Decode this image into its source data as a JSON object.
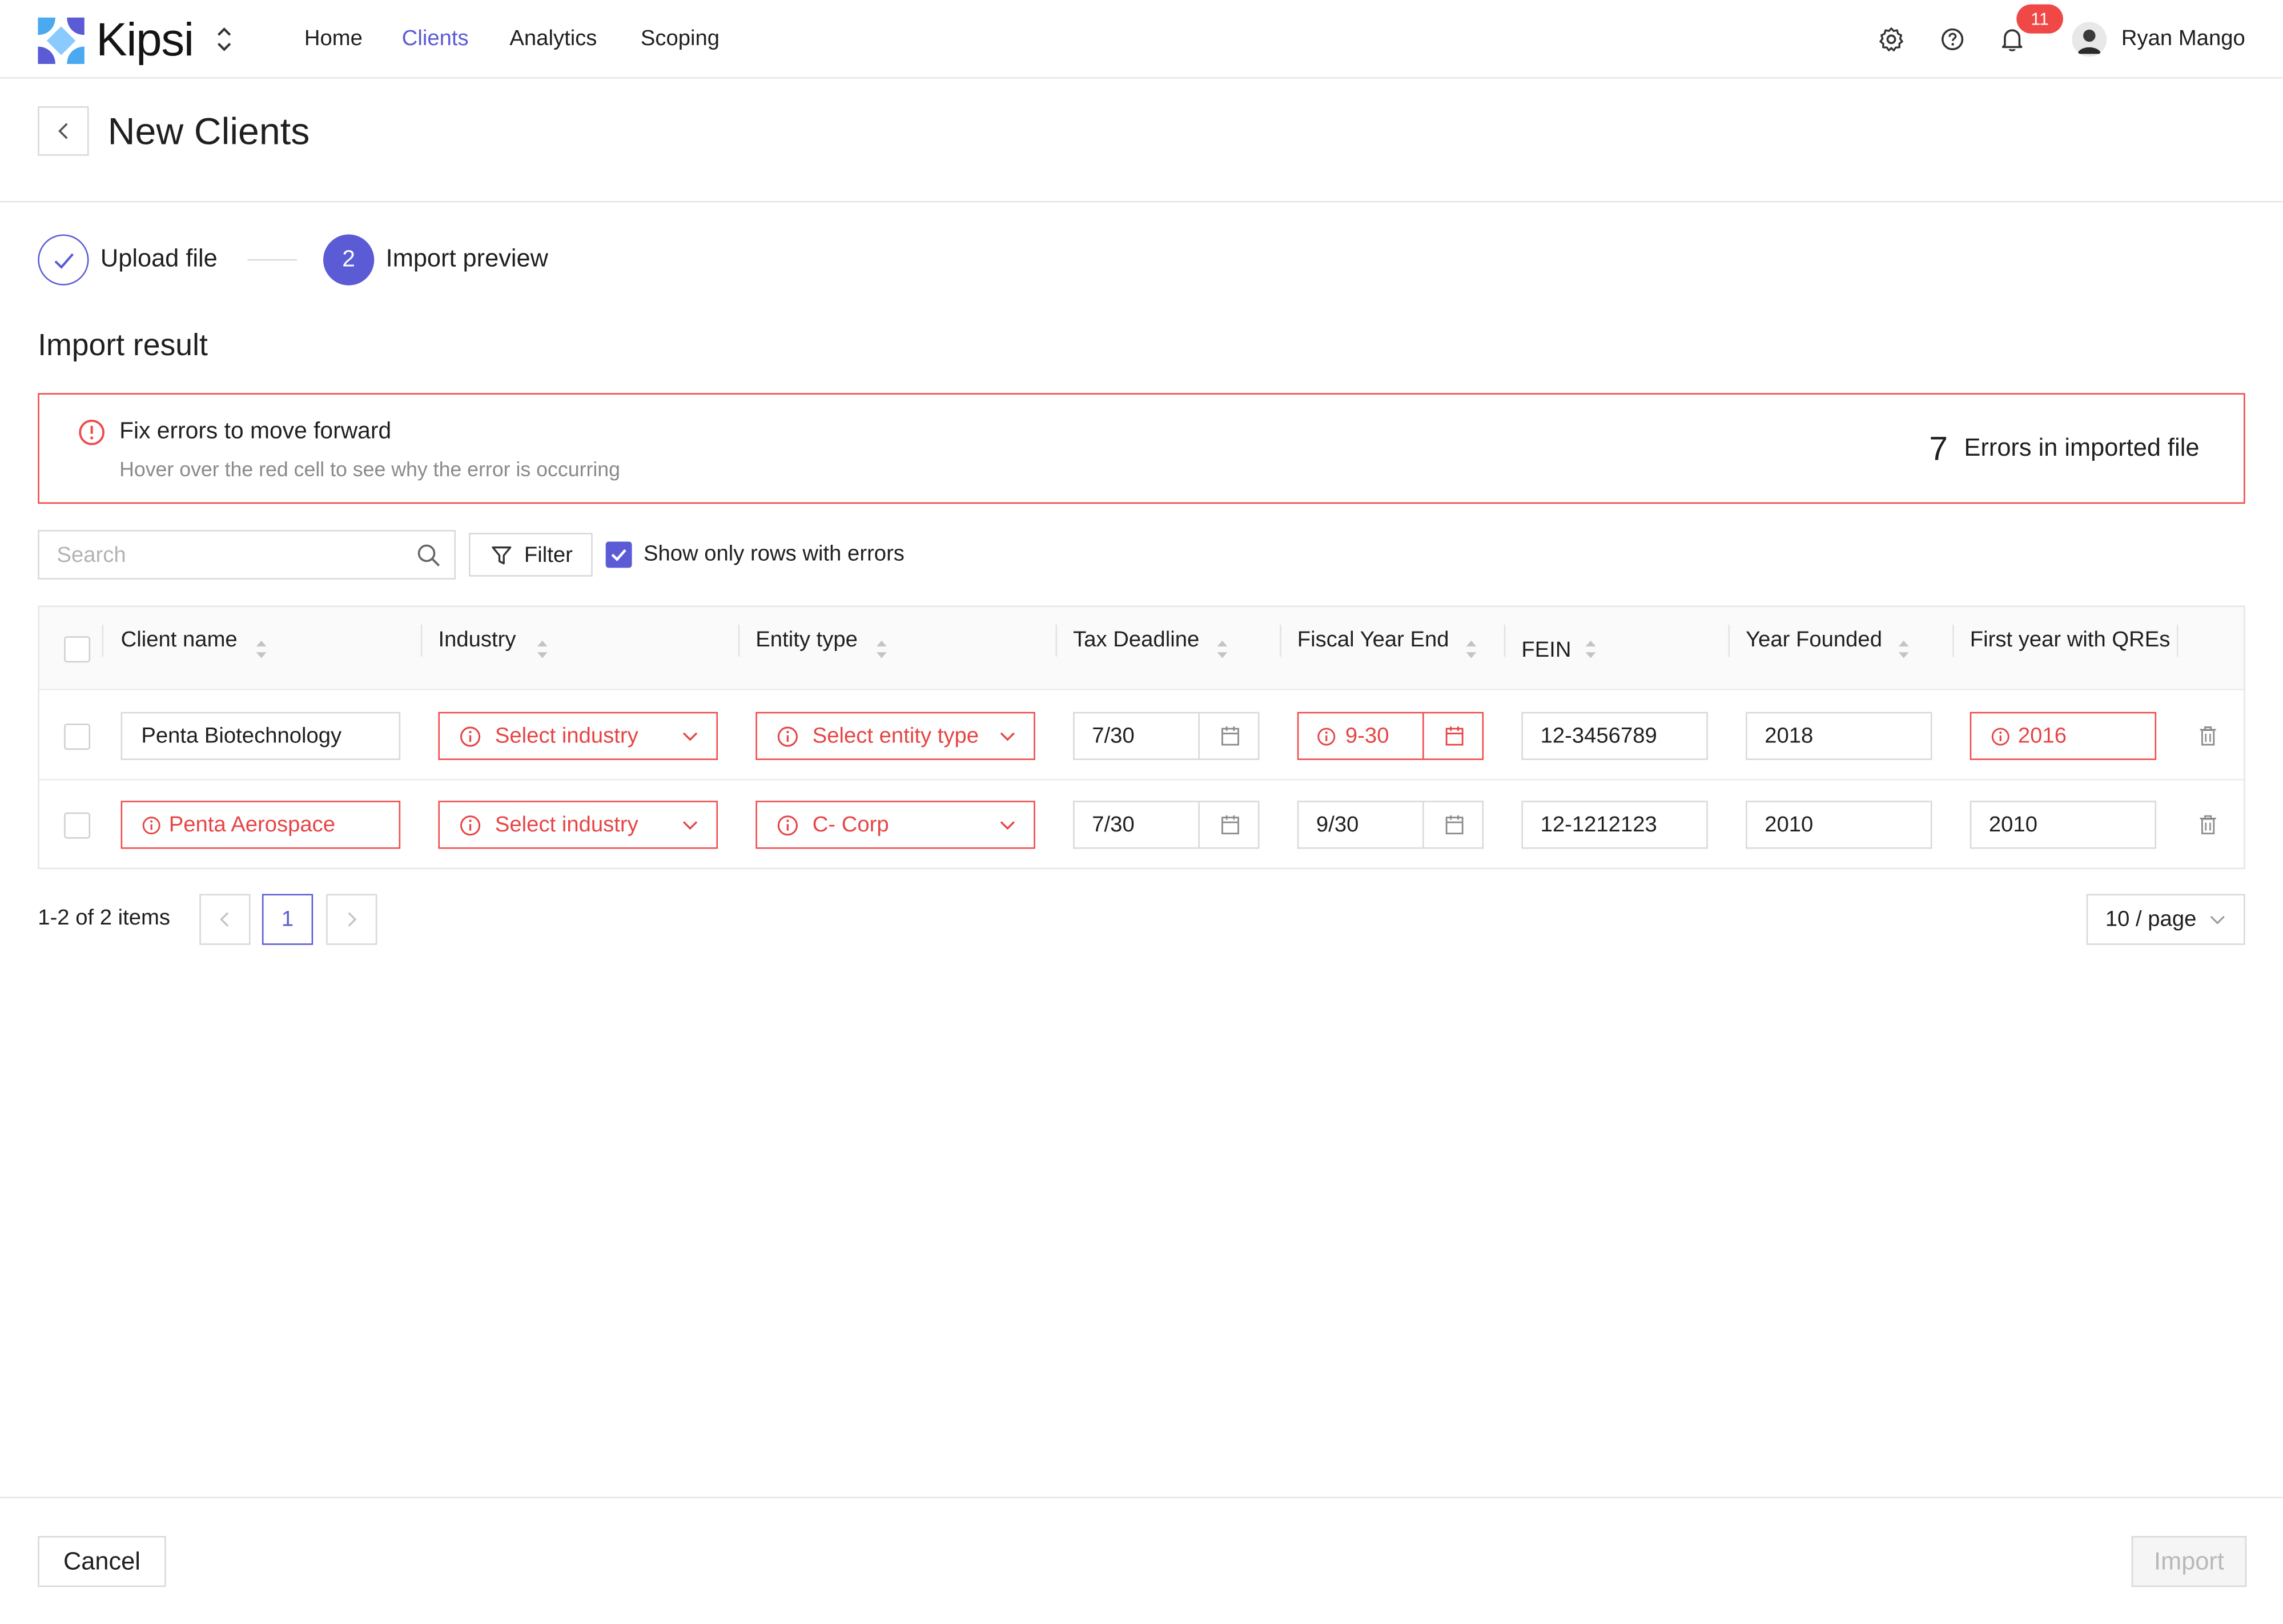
{
  "app": {
    "brand": "Kipsi",
    "nav": [
      {
        "label": "Home",
        "active": false
      },
      {
        "label": "Clients",
        "active": true
      },
      {
        "label": "Analytics",
        "active": false
      },
      {
        "label": "Scoping",
        "active": false
      }
    ],
    "icons": [
      "settings-icon",
      "help-icon",
      "bell-icon"
    ],
    "notifications_count": "11",
    "user_name": "Ryan Mango"
  },
  "page": {
    "title": "New Clients"
  },
  "steps": [
    {
      "label": "Upload file",
      "status": "done"
    },
    {
      "number": "2",
      "label": "Import preview",
      "status": "current"
    }
  ],
  "import_result": {
    "title": "Import result",
    "banner": {
      "title": "Fix errors to move forward",
      "subtitle": "Hover over the red cell to see why the error is occurring",
      "error_count": "7",
      "error_count_label": "Errors in imported file"
    }
  },
  "toolbar": {
    "search_placeholder": "Search",
    "filter_label": "Filter",
    "show_errors_label": "Show only rows with errors",
    "show_errors_checked": true
  },
  "table": {
    "columns": [
      "Client name",
      "Industry",
      "Entity type",
      "Tax Deadline",
      "Fiscal Year End",
      "FEIN",
      "Year Founded",
      "First year with QREs"
    ],
    "rows": [
      {
        "client_name": {
          "value": "Penta Biotechnology",
          "error": false
        },
        "industry": {
          "value": "Select industry",
          "error": true
        },
        "entity_type": {
          "value": "Select entity type",
          "error": true
        },
        "tax_deadline": {
          "value": "7/30",
          "error": false
        },
        "fiscal_year_end": {
          "value": "9-30",
          "error": true
        },
        "fein": {
          "value": "12-3456789",
          "error": false
        },
        "year_founded": {
          "value": "2018",
          "error": false
        },
        "first_year_qres": {
          "value": "2016",
          "error": true
        }
      },
      {
        "client_name": {
          "value": "Penta Aerospace",
          "error": true
        },
        "industry": {
          "value": "Select industry",
          "error": true
        },
        "entity_type": {
          "value": "C- Corp",
          "error": true
        },
        "tax_deadline": {
          "value": "7/30",
          "error": false
        },
        "fiscal_year_end": {
          "value": "9/30",
          "error": false
        },
        "fein": {
          "value": "12-1212123",
          "error": false
        },
        "year_founded": {
          "value": "2010",
          "error": false
        },
        "first_year_qres": {
          "value": "2010",
          "error": false
        }
      }
    ]
  },
  "pagination": {
    "total_label": "1-2 of 2 items",
    "current_page": "1",
    "page_size_label": "10 / page"
  },
  "footer": {
    "cancel_label": "Cancel",
    "import_label": "Import"
  },
  "colors": {
    "accent": "#5b5bd6",
    "error": "#ef4b4b",
    "badge": "#f04747",
    "border": "#d9d9d9"
  }
}
